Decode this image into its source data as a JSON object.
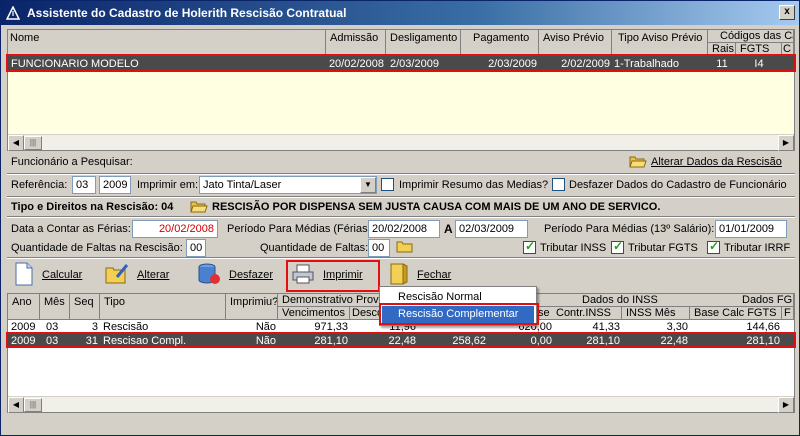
{
  "window": {
    "title": "Assistente do Cadastro de Holerith Rescisão Contratual",
    "close": "x"
  },
  "top_grid": {
    "headers": {
      "nome": "Nome",
      "admissao": "Admissão",
      "desligamento": "Desligamento",
      "pagamento": "Pagamento",
      "aviso_previo": "Aviso  Prévio",
      "tipo_aviso": "Tipo Aviso Prévio",
      "codigos": "Códigos das Ca",
      "rais": "Rais",
      "fgts": "FGTS",
      "c": "C"
    },
    "row": {
      "nome": "FUNCIONARIO MODELO",
      "admissao": "20/02/2008",
      "desligamento": "2/03/2009",
      "pagamento": "2/03/2009",
      "aviso_previo": "2/02/2009",
      "tipo_aviso": "1-Trabalhado",
      "rais": "11",
      "fgts": "I4"
    }
  },
  "search": {
    "label": "Funcionário a Pesquisar:",
    "alterar_dados": "Alterar Dados da Rescisão"
  },
  "referencia": {
    "label": "Referência:",
    "mes": "03",
    "ano": "2009",
    "imprimir_em_label": "Imprimir em:",
    "printer": "Jato Tinta/Laser",
    "imprimir_resumo": "Imprimir  Resumo das Medias?",
    "desfazer_dados": "Desfazer Dados do Cadastro de Funcionário",
    "imprimir_resumo_checked": false,
    "desfazer_checked": false
  },
  "tipo": {
    "label": "Tipo e Direitos na Rescisão: 04",
    "descricao": "RESCISÃO POR DISPENSA SEM JUSTA CAUSA  COM MAIS  DE UM ANO DE SERVICO."
  },
  "ferias": {
    "data_label": "Data a Contar as Férias:",
    "data_value": "20/02/2008",
    "periodo_label": "Período Para Médias (Férias):",
    "periodo_de": "20/02/2008",
    "a_label": "A",
    "periodo_ate": "02/03/2009",
    "periodo13_label": "Período Para Médias (13º Salário):",
    "periodo13_value": "01/01/2009"
  },
  "faltas": {
    "rescisao_label": "Quantidade de Faltas na Rescisão:",
    "rescisao_value": "00",
    "faltas_label": "Quantidade de Faltas:",
    "faltas_value": "00",
    "tributar_inss": "Tributar INSS",
    "tributar_fgts": "Tributar FGTS",
    "tributar_irrf": "Tributar IRRF",
    "inss_checked": true,
    "fgts_checked": true,
    "irrf_checked": true
  },
  "toolbar": {
    "calcular": "Calcular",
    "alterar": "Alterar",
    "desfazer": "Desfazer",
    "imprimir": "Imprimir",
    "fechar": "Fechar"
  },
  "menu": {
    "items": [
      "Rescisão Normal",
      "Rescisão Complementar"
    ]
  },
  "bottom_grid": {
    "headers": {
      "ano": "Ano",
      "mes": "Mês",
      "seq": "Seq",
      "tipo": "Tipo",
      "imprimiu": "Imprimiu?",
      "demonstrativo": "Demonstrativo Prove",
      "vencimentos": "Vencimentos",
      "descontos": "Desco",
      "se": "se",
      "dados_inss": "Dados do INSS",
      "contr_inss": "Contr.INSS",
      "inss_mes": "INSS Mês",
      "dados_fgts": "Dados FG",
      "base_calc_fgts": "Base Calc FGTS",
      "f": "F"
    },
    "rows": [
      {
        "ano": "2009",
        "mes": "03",
        "seq": "3",
        "tipo": "Rescisão",
        "imprimiu": "Não",
        "vencimentos": "971,33",
        "descontos": "11,96",
        "liquido": "",
        "base": "620,00",
        "contr_inss": "41,33",
        "inss_mes": "3,30",
        "base_fgts": "144,66"
      },
      {
        "ano": "2009",
        "mes": "03",
        "seq": "31",
        "tipo": "Rescisao Compl.",
        "imprimiu": "Não",
        "vencimentos": "281,10",
        "descontos": "22,48",
        "liquido": "258,62",
        "base": "0,00",
        "contr_inss": "281,10",
        "inss_mes": "22,48",
        "base_fgts": "281,10"
      }
    ]
  },
  "colors": {
    "selected_row": "#4a4a4a",
    "highlight_red": "#e01010",
    "menu_highlight": "#316ac5",
    "title_start": "#0a246a"
  }
}
